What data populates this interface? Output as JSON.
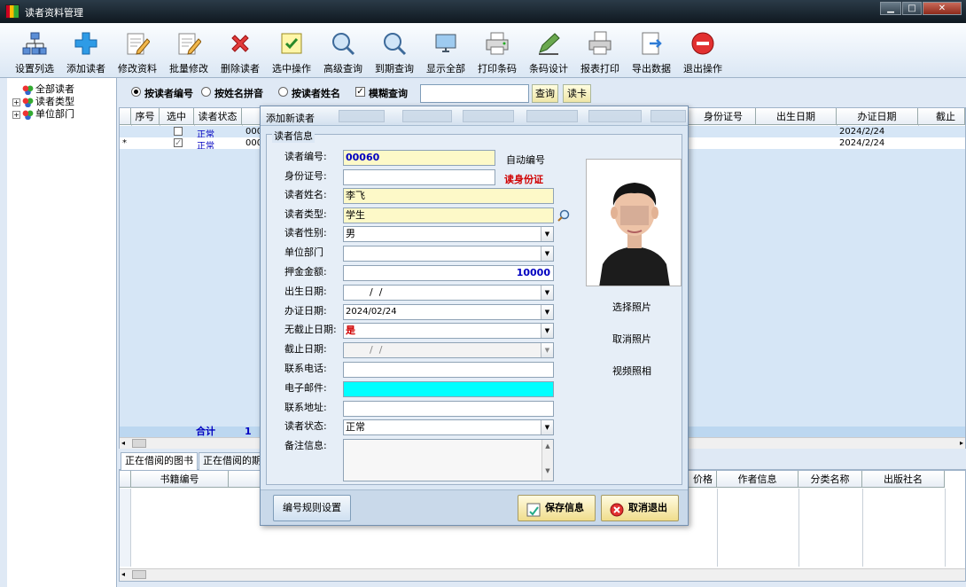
{
  "window": {
    "title": "读者资料管理"
  },
  "toolbar": {
    "items": [
      {
        "label": "设置列选",
        "icon": "org-chart-icon"
      },
      {
        "label": "添加读者",
        "icon": "plus-icon"
      },
      {
        "label": "修改资料",
        "icon": "edit-icon"
      },
      {
        "label": "批量修改",
        "icon": "batch-edit-icon"
      },
      {
        "label": "删除读者",
        "icon": "delete-icon"
      },
      {
        "label": "选中操作",
        "icon": "checkbox-icon"
      },
      {
        "label": "高级查询",
        "icon": "search-icon"
      },
      {
        "label": "到期查询",
        "icon": "search-icon"
      },
      {
        "label": "显示全部",
        "icon": "monitor-icon"
      },
      {
        "label": "打印条码",
        "icon": "printer-icon"
      },
      {
        "label": "条码设计",
        "icon": "pen-icon"
      },
      {
        "label": "报表打印",
        "icon": "report-print-icon"
      },
      {
        "label": "导出数据",
        "icon": "export-icon"
      },
      {
        "label": "退出操作",
        "icon": "exit-icon"
      }
    ]
  },
  "tree": {
    "items": [
      {
        "label": "全部读者"
      },
      {
        "label": "读者类型"
      },
      {
        "label": "单位部门"
      }
    ]
  },
  "search": {
    "opt1": "按读者编号",
    "opt2": "按姓名拼音",
    "opt3": "按读者姓名",
    "fuzzy": "模糊查询",
    "query_btn": "查询",
    "card_btn": "读卡",
    "value": ""
  },
  "grid": {
    "columns": [
      "序号",
      "选中",
      "读者状态",
      "身份证号",
      "出生日期",
      "办证日期",
      "截止"
    ],
    "rows": [
      {
        "status": "正常",
        "code": "000",
        "issue": "2024/2/24"
      },
      {
        "status": "正常",
        "code": "000",
        "issue": "2024/2/24"
      }
    ],
    "total_label": "合计",
    "total_count": "1"
  },
  "tabs": [
    "正在借阅的图书",
    "正在借阅的期"
  ],
  "bottom_grid": {
    "columns": [
      "书籍编号",
      "价格",
      "作者信息",
      "分类名称",
      "出版社名"
    ]
  },
  "dialog": {
    "title": "添加新读者",
    "group": "读者信息",
    "fields": {
      "id": {
        "label": "读者编号:",
        "value": "00060",
        "hint": "自动编号"
      },
      "idcard": {
        "label": "身份证号:",
        "value": "",
        "link": "读身份证"
      },
      "name": {
        "label": "读者姓名:",
        "value": "李飞"
      },
      "type": {
        "label": "读者类型:",
        "value": "学生"
      },
      "gender": {
        "label": "读者性别:",
        "value": "男"
      },
      "dept": {
        "label": "单位部门",
        "value": ""
      },
      "deposit": {
        "label": "押金金额:",
        "value": "10000"
      },
      "birth": {
        "label": "出生日期:",
        "value": "  /  /"
      },
      "issue": {
        "label": "办证日期:",
        "value": "2024/02/24"
      },
      "noexpire": {
        "label": "无截止日期:",
        "value": "是"
      },
      "expire": {
        "label": "截止日期:",
        "value": "  /  /"
      },
      "phone": {
        "label": "联系电话:",
        "value": ""
      },
      "email": {
        "label": "电子邮件:",
        "value": ""
      },
      "address": {
        "label": "联系地址:",
        "value": ""
      },
      "status": {
        "label": "读者状态:",
        "value": "正常"
      },
      "note": {
        "label": "备注信息:",
        "value": ""
      }
    },
    "photo_actions": [
      "选择照片",
      "取消照片",
      "视频照相"
    ],
    "rule_btn": "编号规则设置",
    "save_btn": "保存信息",
    "cancel_btn": "取消退出"
  },
  "colors": {
    "accent": "#dfe9f5",
    "highlight": "#fdf9c8",
    "email": "#00ffff",
    "blue": "#0000c0",
    "red": "#d00000"
  }
}
